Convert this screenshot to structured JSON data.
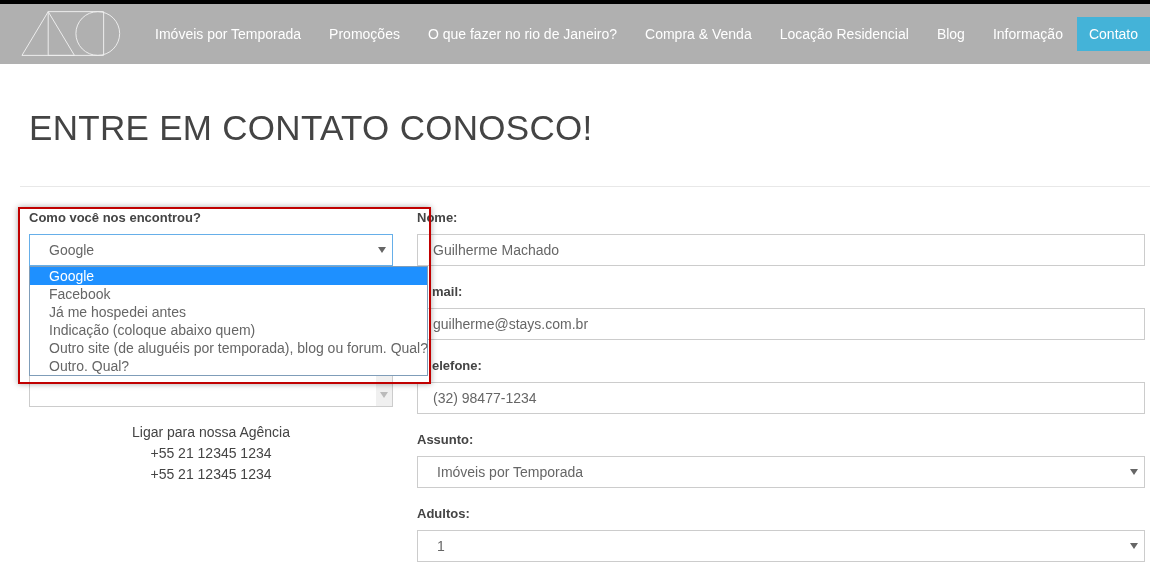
{
  "nav": {
    "items": [
      {
        "label": "Imóveis por Temporada",
        "selected": false
      },
      {
        "label": "Promoções",
        "selected": false
      },
      {
        "label": "O que fazer no rio de Janeiro?",
        "selected": false
      },
      {
        "label": "Compra & Venda",
        "selected": false
      },
      {
        "label": "Locação Residencial",
        "selected": false
      },
      {
        "label": "Blog",
        "selected": false
      },
      {
        "label": "Informação",
        "selected": false
      },
      {
        "label": "Contato",
        "selected": true
      }
    ]
  },
  "title": "ENTRE EM CONTATO CONOSCO!",
  "source": {
    "label": "Como você nos encontrou?",
    "value": "Google",
    "options": [
      {
        "label": "Google",
        "selected": true
      },
      {
        "label": "Facebook",
        "selected": false
      },
      {
        "label": "Já me hospedei antes",
        "selected": false
      },
      {
        "label": "Indicação (coloque abaixo quem)",
        "selected": false
      },
      {
        "label": "Outro site (de aluguéis por temporada), blog ou forum. Qual?",
        "selected": false
      },
      {
        "label": "Outro. Qual?",
        "selected": false
      }
    ]
  },
  "agency": {
    "label": "Ligar para nossa Agência",
    "phones": [
      "+55 21 12345 1234",
      "+55 21 12345 1234"
    ]
  },
  "fields": [
    {
      "kind": "input",
      "label": "Nome:",
      "value": "Guilherme Machado",
      "partial": false
    },
    {
      "kind": "input",
      "label": "mail:",
      "value": "guilherme@stays.com.br",
      "partial": true
    },
    {
      "kind": "input",
      "label": "elefone:",
      "value": "(32) 98477-1234",
      "partial": true
    },
    {
      "kind": "select",
      "label": "Assunto:",
      "value": "Imóveis por Temporada",
      "partial": false
    },
    {
      "kind": "select",
      "label": "Adultos:",
      "value": "1",
      "partial": false
    }
  ]
}
